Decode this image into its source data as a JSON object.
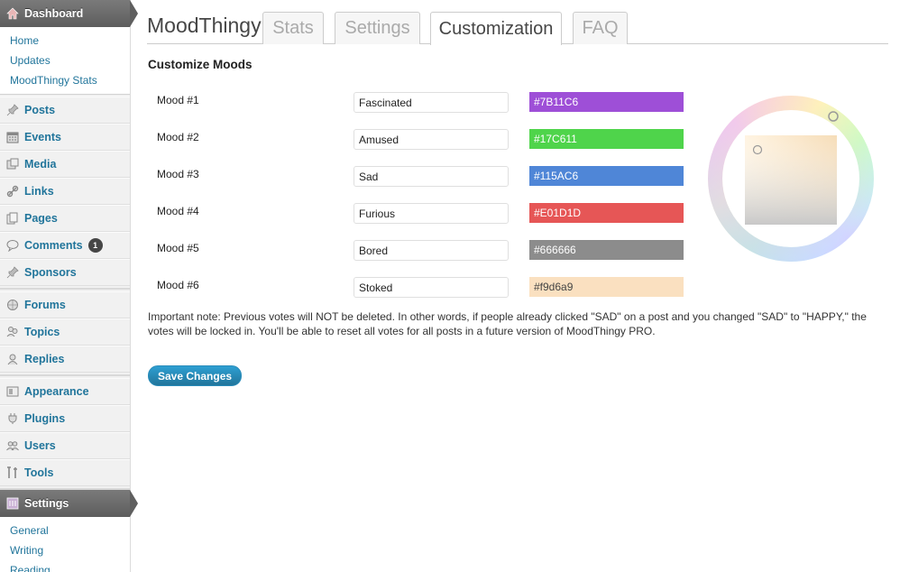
{
  "sidebar": {
    "dashboard": {
      "label": "Dashboard",
      "icon": "house-icon"
    },
    "dashboard_sub": [
      "Home",
      "Updates",
      "MoodThingy Stats"
    ],
    "group1": [
      {
        "label": "Posts",
        "icon": "pushpin-icon"
      },
      {
        "label": "Events",
        "icon": "calendar-icon"
      },
      {
        "label": "Media",
        "icon": "media-icon"
      },
      {
        "label": "Links",
        "icon": "link-icon"
      },
      {
        "label": "Pages",
        "icon": "pages-icon"
      },
      {
        "label": "Comments",
        "icon": "speech-bubble-icon",
        "badge": "1"
      },
      {
        "label": "Sponsors",
        "icon": "pushpin-icon"
      }
    ],
    "group2": [
      {
        "label": "Forums",
        "icon": "globe-icon"
      },
      {
        "label": "Topics",
        "icon": "people-icon"
      },
      {
        "label": "Replies",
        "icon": "reply-icon"
      }
    ],
    "group3": [
      {
        "label": "Appearance",
        "icon": "appearance-icon"
      },
      {
        "label": "Plugins",
        "icon": "plug-icon"
      },
      {
        "label": "Users",
        "icon": "users-icon"
      },
      {
        "label": "Tools",
        "icon": "tools-icon"
      }
    ],
    "settings": {
      "label": "Settings",
      "icon": "settings-icon"
    },
    "settings_sub": [
      "General",
      "Writing",
      "Reading"
    ]
  },
  "header": {
    "plugin_title": "MoodThingy",
    "tabs": [
      "Stats",
      "Settings",
      "Customization",
      "FAQ"
    ],
    "active_tab": "Customization"
  },
  "section_title": "Customize Moods",
  "moods": [
    {
      "label": "Mood #1",
      "name": "Fascinated",
      "color": "#7B11C6",
      "swatch": "#9e4fd7",
      "text_color": "#ffffff"
    },
    {
      "label": "Mood #2",
      "name": "Amused",
      "color": "#17C611",
      "swatch": "#4fd44b",
      "text_color": "#ffffff"
    },
    {
      "label": "Mood #3",
      "name": "Sad",
      "color": "#115AC6",
      "swatch": "#4f86d7",
      "text_color": "#ffffff"
    },
    {
      "label": "Mood #4",
      "name": "Furious",
      "color": "#E01D1D",
      "swatch": "#e65656",
      "text_color": "#ffffff"
    },
    {
      "label": "Mood #5",
      "name": "Bored",
      "color": "#666666",
      "swatch": "#8c8c8c",
      "text_color": "#ffffff"
    },
    {
      "label": "Mood #6",
      "name": "Stoked",
      "color": "#f9d6a9",
      "swatch": "#fae0c0",
      "text_color": "#444444"
    }
  ],
  "note": "Important note: Previous votes will NOT be deleted. In other words, if people already clicked \"SAD\" on a post and you changed \"SAD\" to \"HAPPY,\" the votes will be locked in. You'll be able to reset all votes for all posts in a future version of MoodThingy PRO.",
  "save_label": "Save Changes"
}
